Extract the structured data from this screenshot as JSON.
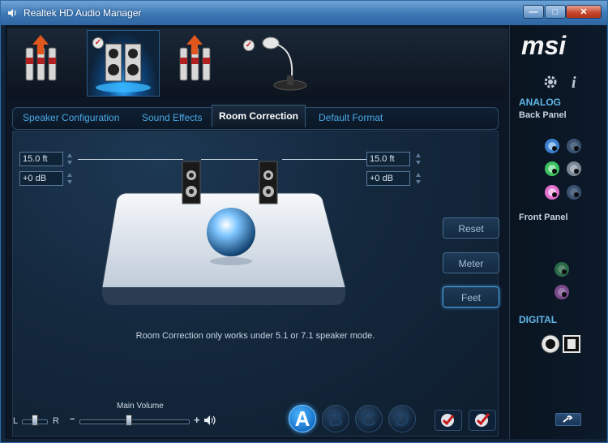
{
  "window": {
    "title": "Realtek HD Audio Manager",
    "min_symbol": "—",
    "max_symbol": "□",
    "close_symbol": "✕"
  },
  "devices": [
    {
      "name": "line-in-rear",
      "selected": false,
      "checked": false
    },
    {
      "name": "speakers",
      "selected": true,
      "checked": true
    },
    {
      "name": "line-in-front",
      "selected": false,
      "checked": false
    },
    {
      "name": "microphone",
      "selected": false,
      "checked": true
    }
  ],
  "tabs": [
    {
      "label": "Speaker Configuration"
    },
    {
      "label": "Sound Effects"
    },
    {
      "label": "Room Correction",
      "active": true
    },
    {
      "label": "Default Format"
    }
  ],
  "room_correction": {
    "left": {
      "distance": "15.0 ft",
      "gain": "+0 dB"
    },
    "right": {
      "distance": "15.0 ft",
      "gain": "+0 dB"
    },
    "buttons": {
      "reset": "Reset",
      "meter": "Meter",
      "feet": "Feet"
    },
    "notice": "Room Correction only works under 5.1 or 7.1 speaker mode."
  },
  "bottom": {
    "balance_left": "L",
    "balance_right": "R",
    "main_volume_label": "Main Volume",
    "minus": "−",
    "plus": "+",
    "balance": 0.5,
    "volume": 0.45,
    "presets": [
      "A",
      "B",
      "C",
      "D"
    ],
    "active_preset": "A"
  },
  "brand": {
    "logo": "msi",
    "analog_title": "ANALOG",
    "back_panel": "Back Panel",
    "front_panel": "Front Panel",
    "digital_title": "DIGITAL"
  },
  "colors": {
    "accent": "#4aa8e6",
    "jack_blue": "#3a7fd0",
    "jack_green": "#3cc060",
    "jack_pink": "#e070d0"
  }
}
